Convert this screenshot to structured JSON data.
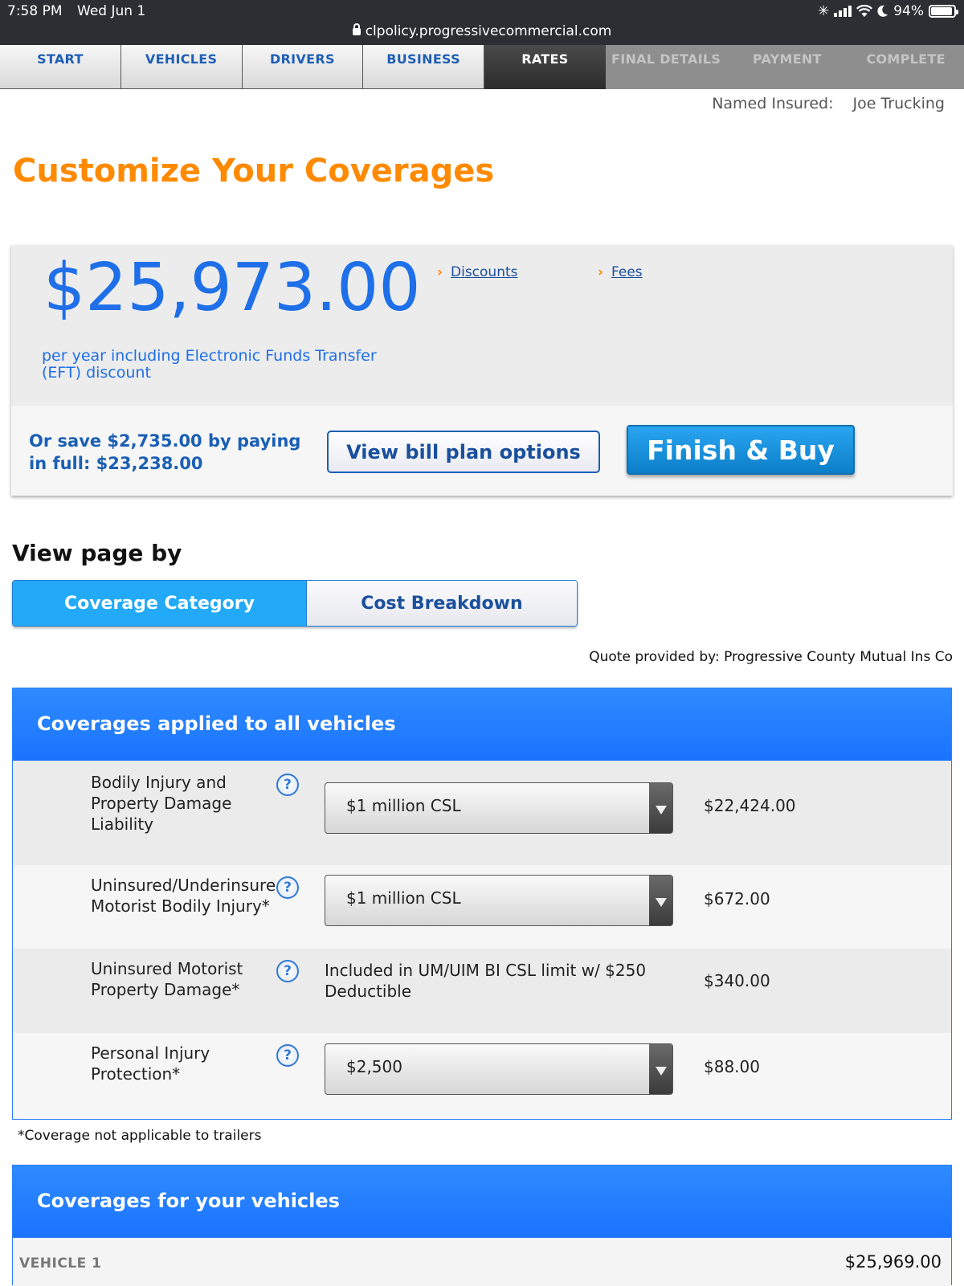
{
  "status_bar": {
    "time": "7:58 PM",
    "date": "Wed Jun 1",
    "battery": "94%",
    "url": "clpolicy.progressivecommercial.com"
  },
  "nav": {
    "tabs": [
      {
        "label": "START",
        "state": "done"
      },
      {
        "label": "VEHICLES",
        "state": "done"
      },
      {
        "label": "DRIVERS",
        "state": "done"
      },
      {
        "label": "BUSINESS",
        "state": "done"
      },
      {
        "label": "RATES",
        "state": "active"
      },
      {
        "label": "FINAL DETAILS",
        "state": "future"
      },
      {
        "label": "PAYMENT",
        "state": "future"
      },
      {
        "label": "COMPLETE",
        "state": "future"
      }
    ]
  },
  "named_insured": {
    "label": "Named Insured:",
    "value": "Joe Trucking"
  },
  "page_title": "Customize Your Coverages",
  "price_card": {
    "price": "$25,973.00",
    "note": "per year including Electronic Funds Transfer (EFT) discount",
    "discounts_link": "Discounts",
    "fees_link": "Fees",
    "save_text": "Or save $2,735.00 by paying in full: $23,238.00",
    "bill_plan_button": "View bill plan options",
    "buy_button": "Finish & Buy"
  },
  "view_by": {
    "heading": "View page by",
    "options": [
      "Coverage Category",
      "Cost Breakdown"
    ],
    "selected": "Coverage Category"
  },
  "quote_provider": "Quote provided by: Progressive County Mutual Ins Co",
  "coverages_all": {
    "heading": "Coverages applied to all vehicles",
    "rows": [
      {
        "label": "Bodily Injury and Property Damage Liability",
        "value": "$1 million CSL",
        "type": "select",
        "amount": "$22,424.00"
      },
      {
        "label": "Uninsured/Underinsured Motorist Bodily Injury*",
        "value": "$1 million CSL",
        "type": "select",
        "amount": "$672.00"
      },
      {
        "label": "Uninsured Motorist Property Damage*",
        "value": "Included in UM/UIM BI CSL limit w/ $250 Deductible",
        "type": "static",
        "amount": "$340.00"
      },
      {
        "label": "Personal Injury Protection*",
        "value": "$2,500",
        "type": "select",
        "amount": "$88.00"
      }
    ],
    "help_glyph": "?"
  },
  "footnote": "*Coverage not applicable to trailers",
  "coverages_vehicles": {
    "heading": "Coverages for your vehicles",
    "vehicle_label": "VEHICLE 1",
    "vehicle_amount": "$25,969.00"
  },
  "colors": {
    "accent_orange": "#ff8a00",
    "price_blue": "#1e6fe8",
    "panel_blue": "#1a73ff",
    "toggle_active": "#22aaf8"
  }
}
